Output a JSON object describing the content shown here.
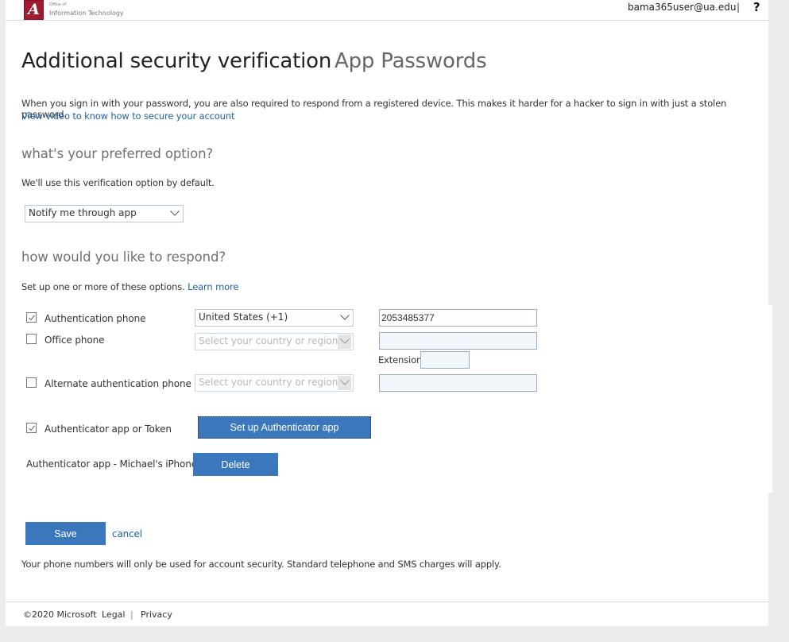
{
  "header": {
    "logo_glyph": "A",
    "logo_small": "Office of",
    "logo_text": "Information Technology",
    "user_email": "bama365user@ua.edu",
    "separator": "|",
    "help_label": "?"
  },
  "page": {
    "title": "Additional security verification",
    "tab_app_passwords": "App Passwords",
    "intro": "When you sign in with your password, you are also required to respond from a registered device. This makes it harder for a hacker to sign in with just a stolen password.",
    "intro_link": "View video to know how to secure your account"
  },
  "preferred": {
    "heading": "what's your preferred option?",
    "description": "We'll use this verification option by default.",
    "selected": "Notify me through app"
  },
  "respond": {
    "heading": "how would you like to respond?",
    "description": "Set up one or more of these options.",
    "learn_more": "Learn more",
    "options": [
      {
        "label": "Authentication phone",
        "checked": true,
        "country": "United States (+1)",
        "phone": "2053485377"
      },
      {
        "label": "Office phone",
        "checked": false,
        "country_placeholder": "Select your country or region",
        "phone": "",
        "extension_label": "Extension",
        "extension": ""
      },
      {
        "label": "Alternate authentication phone",
        "checked": false,
        "country_placeholder": "Select your country or region",
        "phone": ""
      },
      {
        "label": "Authenticator app or Token",
        "checked": true,
        "button": "Set up Authenticator app"
      }
    ],
    "device": {
      "label": "Authenticator app - Michael's iPhone",
      "delete_button": "Delete"
    }
  },
  "actions": {
    "save": "Save",
    "cancel": "cancel",
    "disclaimer": "Your phone numbers will only be used for account security. Standard telephone and SMS charges will apply."
  },
  "footer": {
    "copyright": "©2020 Microsoft",
    "legal": "Legal",
    "separator": "|",
    "privacy": "Privacy"
  },
  "colors": {
    "brand_crimson": "#9e1b32",
    "button_blue": "#3b77bd",
    "link_blue": "#1e62a8"
  }
}
